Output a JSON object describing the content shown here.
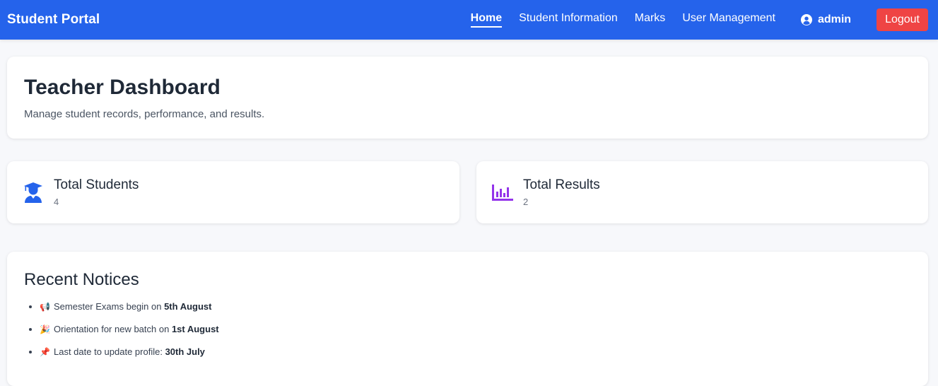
{
  "navbar": {
    "brand": "Student Portal",
    "links": [
      {
        "label": "Home",
        "active": true
      },
      {
        "label": "Student Information",
        "active": false
      },
      {
        "label": "Marks",
        "active": false
      },
      {
        "label": "User Management",
        "active": false
      }
    ],
    "user": {
      "name": "admin",
      "icon": "user-circle-icon"
    },
    "logout_label": "Logout"
  },
  "hero": {
    "title": "Teacher Dashboard",
    "subtitle": "Manage student records, performance, and results."
  },
  "stats": [
    {
      "title": "Total Students",
      "value": "4",
      "icon": "graduate-icon",
      "color": "#2563eb"
    },
    {
      "title": "Total Results",
      "value": "2",
      "icon": "bar-chart-icon",
      "color": "#9333ea"
    }
  ],
  "notices": {
    "title": "Recent Notices",
    "items": [
      {
        "emoji": "📢",
        "text": "Semester Exams begin on ",
        "highlight": "5th August"
      },
      {
        "emoji": "🎉",
        "text": "Orientation for new batch on ",
        "highlight": "1st August"
      },
      {
        "emoji": "📌",
        "text": "Last date to update profile: ",
        "highlight": "30th July"
      }
    ]
  },
  "colors": {
    "primary": "#2563eb",
    "danger": "#ef4444",
    "accent": "#9333ea",
    "background": "#f7f8fb"
  }
}
